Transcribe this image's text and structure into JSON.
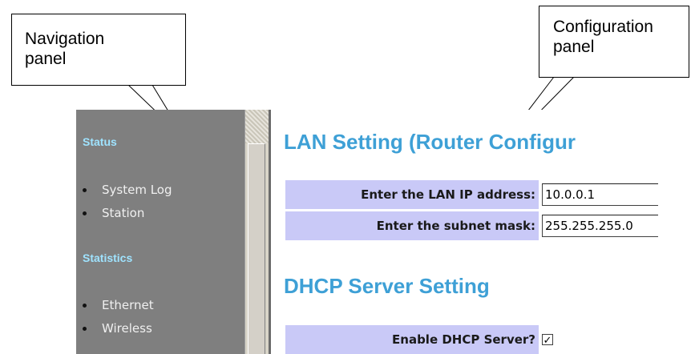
{
  "callouts": {
    "navigation": {
      "line1": "Navigation",
      "line2": "panel"
    },
    "configuration": {
      "line1": "Configuration",
      "line2": "panel"
    }
  },
  "nav": {
    "sections": [
      {
        "title": "Status",
        "items": [
          {
            "label": "System Log"
          },
          {
            "label": "Station"
          }
        ]
      },
      {
        "title": "Statistics",
        "items": [
          {
            "label": "Ethernet"
          },
          {
            "label": "Wireless"
          }
        ]
      }
    ]
  },
  "main": {
    "lan_heading": "LAN Setting (Router Configur",
    "lan_fields": [
      {
        "label": "Enter the LAN IP address:",
        "value": "10.0.0.1"
      },
      {
        "label": "Enter the subnet mask:",
        "value": "255.255.255.0"
      }
    ],
    "dhcp_heading": "DHCP Server Setting",
    "dhcp_enable": {
      "label": "Enable DHCP Server?",
      "checked": true,
      "check_glyph": "✓"
    }
  },
  "colors": {
    "nav_background": "#7f7f7f",
    "nav_title": "#9fe3ff",
    "heading": "#3ea0d6",
    "label_background": "#c9c9f7"
  }
}
